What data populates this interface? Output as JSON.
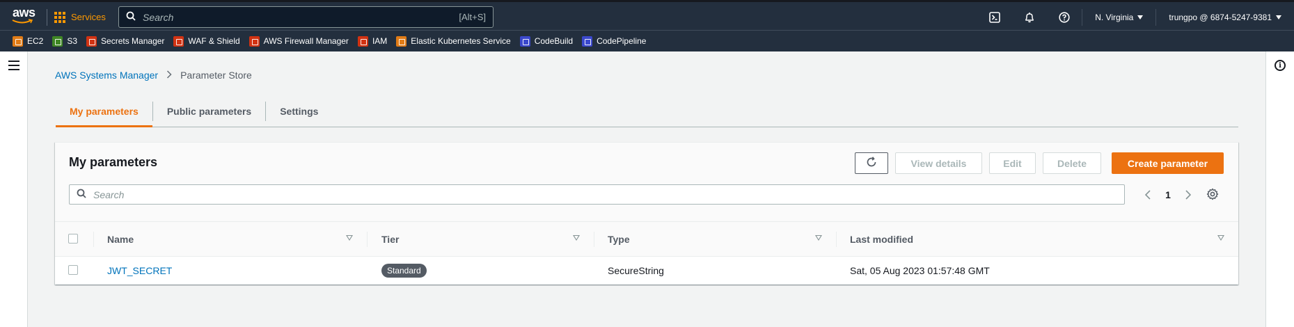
{
  "nav": {
    "logo_text": "aws",
    "services_label": "Services",
    "search_placeholder": "Search",
    "search_shortcut": "[Alt+S]",
    "icons": [
      "cloudshell-icon",
      "bell-icon",
      "help-icon"
    ],
    "region": "N. Virginia",
    "account": "trungpo @ 6874-5247-9381"
  },
  "favorites": [
    {
      "label": "EC2",
      "color": "#e07b16"
    },
    {
      "label": "S3",
      "color": "#3f8624"
    },
    {
      "label": "Secrets Manager",
      "color": "#d13212"
    },
    {
      "label": "WAF & Shield",
      "color": "#d13212"
    },
    {
      "label": "AWS Firewall Manager",
      "color": "#d13212"
    },
    {
      "label": "IAM",
      "color": "#d13212"
    },
    {
      "label": "Elastic Kubernetes Service",
      "color": "#e07b16"
    },
    {
      "label": "CodeBuild",
      "color": "#3b48cc"
    },
    {
      "label": "CodePipeline",
      "color": "#3b48cc"
    }
  ],
  "breadcrumb": {
    "parent": "AWS Systems Manager",
    "current": "Parameter Store"
  },
  "tabs": [
    "My parameters",
    "Public parameters",
    "Settings"
  ],
  "panel": {
    "title": "My parameters",
    "buttons": {
      "view_details": "View details",
      "edit": "Edit",
      "delete": "Delete",
      "create": "Create parameter"
    },
    "filter_placeholder": "Search",
    "page": "1",
    "columns": [
      "Name",
      "Tier",
      "Type",
      "Last modified"
    ],
    "rows": [
      {
        "name": "JWT_SECRET",
        "tier": "Standard",
        "type": "SecureString",
        "last_modified": "Sat, 05 Aug 2023 01:57:48 GMT"
      }
    ]
  },
  "colors": {
    "nav_bg": "#232f3e",
    "accent": "#ec7211",
    "link": "#0073bb"
  }
}
